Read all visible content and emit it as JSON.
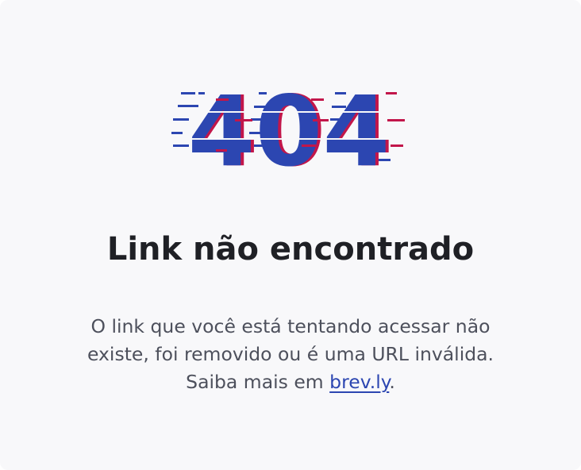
{
  "error_code": "404",
  "title": "Link não encontrado",
  "message": {
    "line_1": "O link que você está tentando acessar não",
    "line_2": "existe, foi removido ou é uma URL inválida.",
    "line_3_prefix": "Saiba mais em ",
    "link_text": "brev.ly",
    "line_3_suffix": "."
  },
  "colors": {
    "background": "#f8f8fa",
    "primary_blue": "#2c46b1",
    "glitch_red": "#c2164a",
    "title": "#1f2025",
    "text": "#4d505c"
  }
}
